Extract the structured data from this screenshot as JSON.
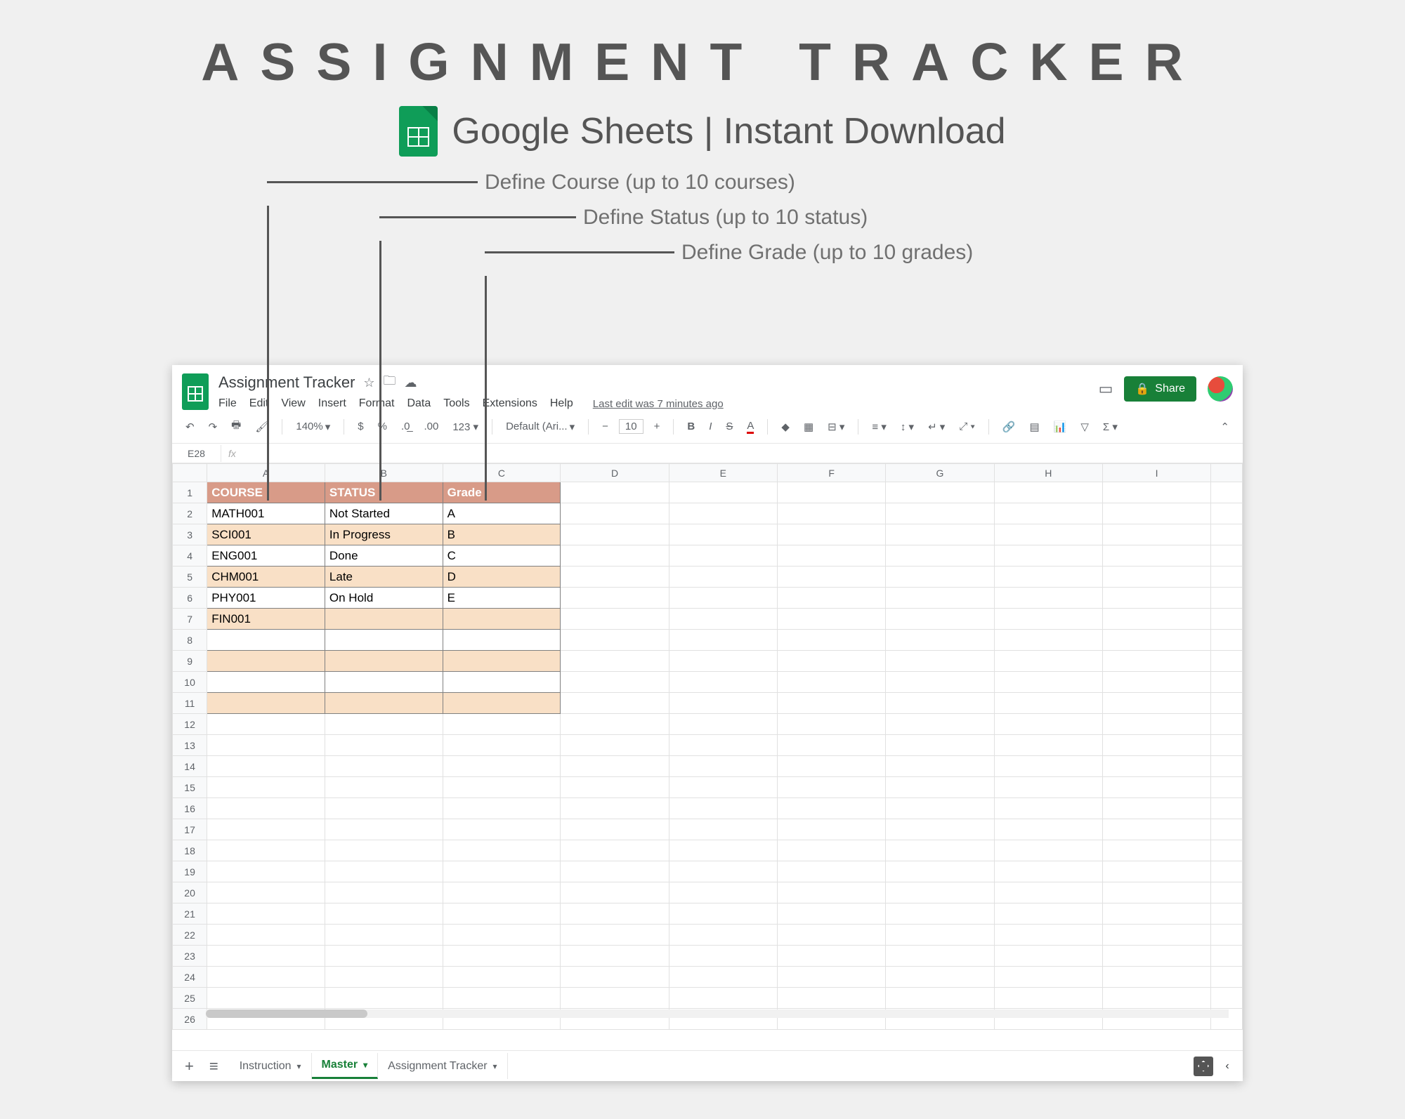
{
  "hero": {
    "title": "ASSIGNMENT TRACKER",
    "subtitle": "Google Sheets | Instant Download"
  },
  "callouts": {
    "course": "Define Course  (up to 10 courses)",
    "status": "Define Status  (up to 10 status)",
    "grade": "Define Grade (up to 10 grades)"
  },
  "doc": {
    "title": "Assignment Tracker",
    "last_edit": "Last edit was 7 minutes ago"
  },
  "menubar": [
    "File",
    "Edit",
    "View",
    "Insert",
    "Format",
    "Data",
    "Tools",
    "Extensions",
    "Help"
  ],
  "toolbar": {
    "zoom": "140%",
    "font": "Default (Ari...",
    "fontsize": "10"
  },
  "share_label": "Share",
  "namebox": "E28",
  "columns": [
    "A",
    "B",
    "C",
    "D",
    "E",
    "F",
    "G",
    "H",
    "I"
  ],
  "headers": {
    "A": "COURSE",
    "B": "STATUS",
    "C": "Grade"
  },
  "rows": [
    {
      "course": "MATH001",
      "status": "Not Started",
      "grade": "A"
    },
    {
      "course": "SCI001",
      "status": "In Progress",
      "grade": "B"
    },
    {
      "course": "ENG001",
      "status": "Done",
      "grade": "C"
    },
    {
      "course": "CHM001",
      "status": "Late",
      "grade": "D"
    },
    {
      "course": "PHY001",
      "status": "On Hold",
      "grade": "E"
    },
    {
      "course": "FIN001",
      "status": "",
      "grade": ""
    },
    {
      "course": "",
      "status": "",
      "grade": ""
    },
    {
      "course": "",
      "status": "",
      "grade": ""
    },
    {
      "course": "",
      "status": "",
      "grade": ""
    },
    {
      "course": "",
      "status": "",
      "grade": ""
    }
  ],
  "total_rows": 26,
  "tabs": [
    {
      "label": "Instruction",
      "active": false
    },
    {
      "label": "Master",
      "active": true
    },
    {
      "label": "Assignment Tracker",
      "active": false
    }
  ]
}
